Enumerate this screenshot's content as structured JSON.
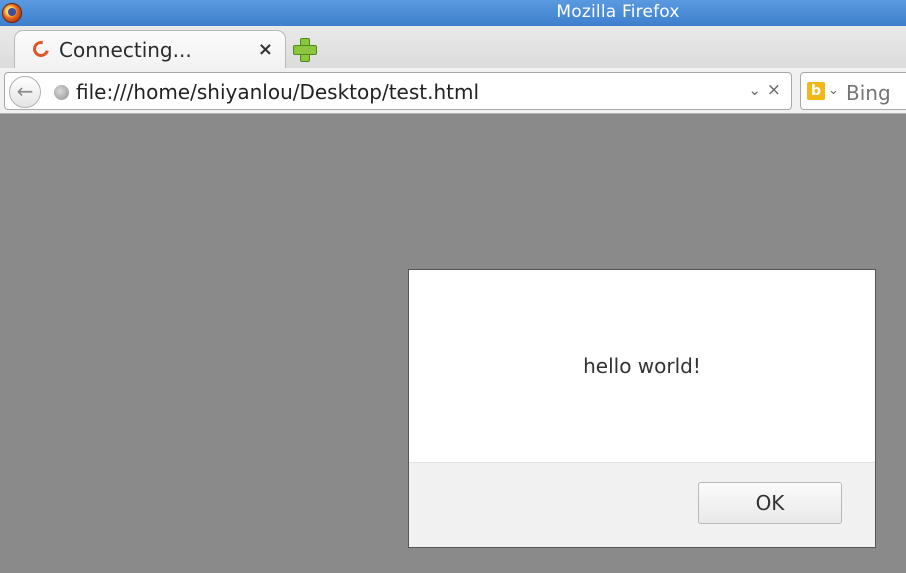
{
  "window": {
    "title": "Mozilla Firefox",
    "app_icon": "firefox-icon"
  },
  "tabs": [
    {
      "label": "Connecting...",
      "icon": "loading-spinner-icon",
      "close_label": "×"
    }
  ],
  "new_tab_icon": "plus-icon",
  "navbar": {
    "back_icon": "back-arrow-icon",
    "back_glyph": "←",
    "site_icon": "globe-icon",
    "url": "file:///home/shiyanlou/Desktop/test.html",
    "dropdown_glyph": "⌄",
    "clear_glyph": "×"
  },
  "search": {
    "engine_icon": "bing-icon",
    "engine_glyph": "b",
    "dropdown_glyph": "⌄",
    "placeholder": "Bing"
  },
  "dialog": {
    "message": "hello world!",
    "ok_label": "OK"
  },
  "colors": {
    "titlebar": "#4a8ad8",
    "page_background": "#8a8a8a",
    "dialog_background": "#ffffff",
    "dialog_footer": "#f1f1f1"
  }
}
